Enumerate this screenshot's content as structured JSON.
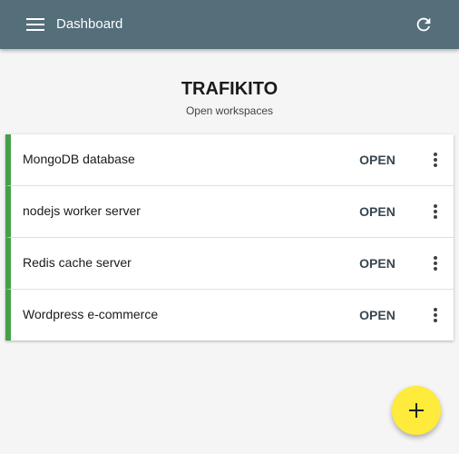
{
  "app_bar": {
    "title": "Dashboard",
    "background": "#546e7a",
    "menu_icon": "hamburger-menu-icon",
    "refresh_icon": "refresh-icon"
  },
  "header": {
    "title": "TRAFIKITO",
    "subtitle": "Open workspaces"
  },
  "workspaces": {
    "accent_color": "#43a047",
    "items": [
      {
        "name": "MongoDB database",
        "action_label": "OPEN"
      },
      {
        "name": "nodejs worker server",
        "action_label": "OPEN"
      },
      {
        "name": "Redis cache server",
        "action_label": "OPEN"
      },
      {
        "name": "Wordpress e-commerce",
        "action_label": "OPEN"
      }
    ],
    "more_icon": "more-vertical-icon"
  },
  "fab": {
    "icon": "plus-icon",
    "color": "#ffeb3b"
  }
}
